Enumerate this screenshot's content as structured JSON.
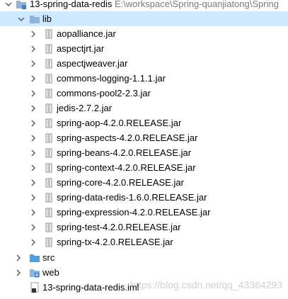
{
  "project": {
    "name": "13-spring-data-redis",
    "path": "E:\\workspace\\Spring-quanjiatong\\Spring"
  },
  "lib_folder": {
    "label": "lib"
  },
  "jars": [
    "aopalliance.jar",
    "aspectjrt.jar",
    "aspectjweaver.jar",
    "commons-logging-1.1.1.jar",
    "commons-pool2-2.3.jar",
    "jedis-2.7.2.jar",
    "spring-aop-4.2.0.RELEASE.jar",
    "spring-aspects-4.2.0.RELEASE.jar",
    "spring-beans-4.2.0.RELEASE.jar",
    "spring-context-4.2.0.RELEASE.jar",
    "spring-core-4.2.0.RELEASE.jar",
    "spring-data-redis-1.6.0.RELEASE.jar",
    "spring-expression-4.2.0.RELEASE.jar",
    "spring-test-4.2.0.RELEASE.jar",
    "spring-tx-4.2.0.RELEASE.jar"
  ],
  "src_folder": {
    "label": "src"
  },
  "web_folder": {
    "label": "web"
  },
  "iml_file": {
    "label": "13-spring-data-redis.iml"
  },
  "watermark": "https://blog.csdn.net/qq_43364293",
  "colors": {
    "selection": "#cde8ff",
    "folder": "#8fb4d8",
    "source_folder": "#4aa3df",
    "jar": "#9a9a9a"
  },
  "icons": {
    "module": "module-folder-icon",
    "folder": "folder-icon",
    "jar": "jar-icon",
    "source": "source-folder-icon",
    "web": "web-folder-icon",
    "iml": "iml-file-icon"
  }
}
